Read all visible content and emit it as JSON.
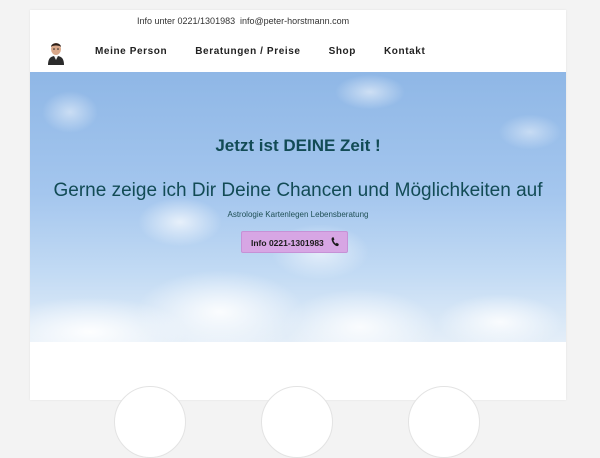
{
  "topbar": {
    "phone_text": "Info unter 0221/1301983",
    "email_text": "info@peter-horstmann.com"
  },
  "nav": {
    "items": [
      {
        "label": "Meine Person"
      },
      {
        "label": "Beratungen / Preise"
      },
      {
        "label": "Shop"
      },
      {
        "label": "Kontakt"
      }
    ]
  },
  "hero": {
    "headline": "Jetzt ist DEINE Zeit !",
    "subheadline": "Gerne zeige ich Dir Deine Chancen und Möglichkeiten auf",
    "tagline": "Astrologie Kartenlegen Lebensberatung",
    "cta_label": "Info 0221-1301983",
    "cta_icon": "phone-icon"
  },
  "colors": {
    "accent_button": "#d7a6e4",
    "headline": "#124b55",
    "sky_top": "#8fb7e6"
  }
}
